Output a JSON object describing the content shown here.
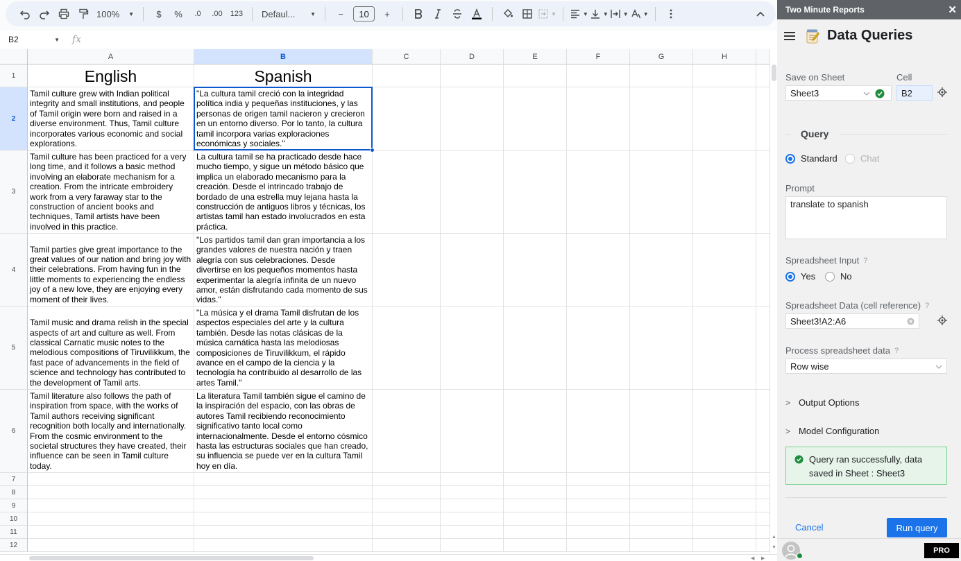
{
  "toolbar": {
    "zoom": "100%",
    "currency": "$",
    "percent": "%",
    "dec_decrease": ".0",
    "dec_increase": ".00",
    "number_format": "123",
    "font": "Defaul...",
    "font_size": "10",
    "minus": "−",
    "plus": "+"
  },
  "formula_bar": {
    "name_box": "B2",
    "fx": "fx"
  },
  "grid": {
    "columns": [
      "A",
      "B",
      "C",
      "D",
      "E",
      "F",
      "G",
      "H"
    ],
    "rows": [
      "1",
      "2",
      "3",
      "4",
      "5",
      "6",
      "7",
      "8",
      "9",
      "10",
      "11",
      "12"
    ],
    "headers": {
      "english": "English",
      "spanish": "Spanish"
    },
    "english": [
      "Tamil culture grew with Indian political integrity and small institutions, and people of Tamil origin were born and raised in a diverse environment. Thus, Tamil culture incorporates various economic and social explorations.",
      "Tamil culture has been practiced for a very long time, and it follows a basic method involving an elaborate mechanism for a creation. From the intricate embroidery work from a very faraway star to the construction of ancient books and techniques, Tamil artists have been involved in this practice.",
      "Tamil parties give great importance to the great values of our nation and bring joy with their celebrations. From having fun in the little moments to experiencing the endless joy of a new love, they are enjoying every moment of their lives.",
      "Tamil music and drama relish in the special aspects of art and culture as well. From classical Carnatic music notes to the melodious compositions of Tiruvilikkum, the fast pace of advancements in the field of science and technology has contributed to the development of Tamil arts.",
      "Tamil literature also follows the path of inspiration from space, with the works of Tamil authors receiving significant recognition both locally and internationally. From the cosmic environment to the societal structures they have created, their influence can be seen in Tamil culture today."
    ],
    "spanish": [
      "\"La cultura tamil creció con la integridad política india y pequeñas instituciones, y las personas de origen tamil nacieron y crecieron en un entorno diverso. Por lo tanto, la cultura tamil incorpora varias exploraciones económicas y sociales.\"",
      "La cultura tamil se ha practicado desde hace mucho tiempo, y sigue un método básico que implica un elaborado mecanismo para la creación. Desde el intrincado trabajo de bordado de una estrella muy lejana hasta la construcción de antiguos libros y técnicas, los artistas tamil han estado involucrados en esta práctica.",
      "\"Los partidos tamil dan gran importancia a los grandes valores de nuestra nación y traen alegría con sus celebraciones. Desde divertirse en los pequeños momentos hasta experimentar la alegría infinita de un nuevo amor, están disfrutando cada momento de sus vidas.\"",
      "\"La música y el drama Tamil disfrutan de los aspectos especiales del arte y la cultura también. Desde las notas clásicas de la música carnática hasta las melodiosas composiciones de Tiruvilikkum, el rápido avance en el campo de la ciencia y la tecnología ha contribuido al desarrollo de las artes Tamil.\"",
      "La literatura Tamil también sigue el camino de la inspiración del espacio, con las obras de autores Tamil recibiendo reconocimiento significativo tanto local como internacionalmente. Desde el entorno cósmico hasta las estructuras sociales que han creado, su influencia se puede ver en la cultura Tamil hoy en día."
    ]
  },
  "panel": {
    "app_title": "Two Minute Reports",
    "close": "✕",
    "heading": "Data Queries",
    "save_label": "Save on Sheet",
    "sheet_value": "Sheet3",
    "cell_label": "Cell",
    "cell_value": "B2",
    "query_title": "Query",
    "mode_standard": "Standard",
    "mode_chat": "Chat",
    "prompt_label": "Prompt",
    "prompt_value": "translate to spanish",
    "ss_input_label": "Spreadsheet Input",
    "yes": "Yes",
    "no": "No",
    "ss_data_label": "Spreadsheet Data (cell reference)",
    "ss_data_value": "Sheet3!A2:A6",
    "process_label": "Process spreadsheet data",
    "process_value": "Row wise",
    "output_options": "Output Options",
    "model_config": "Model Configuration",
    "success_msg": "Query ran successfully, data saved in Sheet : Sheet3",
    "cancel": "Cancel",
    "run": "Run query",
    "pro": "PRO",
    "help_mark": "?"
  },
  "colors": {
    "accent": "#1a73e8",
    "selection": "#0b57d0",
    "success": "#1e8e3e"
  }
}
